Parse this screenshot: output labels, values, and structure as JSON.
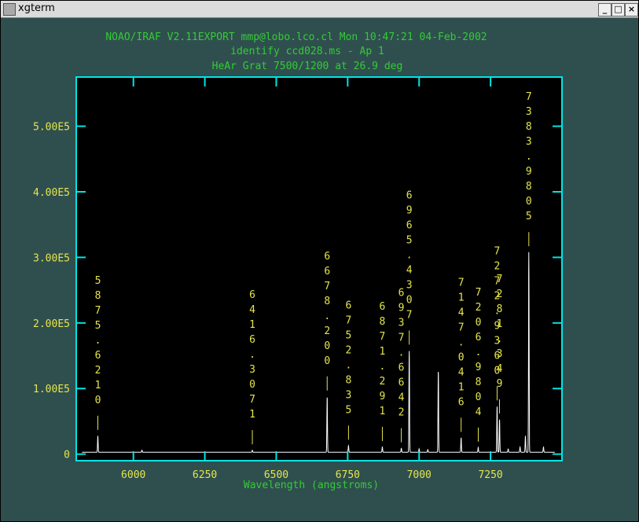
{
  "window": {
    "title": "xgterm",
    "minimize_glyph": "_",
    "maximize_glyph": "□",
    "close_glyph": "×"
  },
  "colors": {
    "background": "#2f4f4f",
    "axes": "#00e5e5",
    "header_text": "#33cc33",
    "tick_labels": "#e5e54c",
    "line_labels": "#e5e54c",
    "spectrum": "#ffffff",
    "plot_bg": "#000000"
  },
  "chart_data": {
    "type": "line",
    "title": "NOAO/IRAF V2.11EXPORT mmp@lobo.lco.cl Mon 10:47:21 04-Feb-2002",
    "subtitle": [
      "identify ccd028.ms - Ap 1",
      "HeAr Grat 7500/1200 at 26.9 deg"
    ],
    "xlabel": "Wavelength (angstroms)",
    "ylabel": "",
    "xlim": [
      5800,
      7500
    ],
    "ylim": [
      -10000,
      575000
    ],
    "xticks": [
      6000,
      6250,
      6500,
      6750,
      7000,
      7250
    ],
    "xtick_labels": [
      "6000",
      "6250",
      "6500",
      "6750",
      "7000",
      "7250"
    ],
    "yticks": [
      0,
      100000,
      200000,
      300000,
      400000,
      500000
    ],
    "ytick_labels": [
      "0",
      "1.00E5",
      "2.00E5",
      "3.00E5",
      "4.00E5",
      "5.00E5"
    ],
    "grid": false,
    "baseline": 3000,
    "peaks": [
      [
        5875.6,
        25000
      ],
      [
        6030,
        3000
      ],
      [
        6416.3,
        3000
      ],
      [
        6678.2,
        85000
      ],
      [
        6752.8,
        10000
      ],
      [
        6871.3,
        8000
      ],
      [
        6937.7,
        6000
      ],
      [
        6965.4,
        155000
      ],
      [
        7000,
        5000
      ],
      [
        7030.3,
        4000
      ],
      [
        7067.2,
        125000
      ],
      [
        7147.0,
        22000
      ],
      [
        7206.9,
        7000
      ],
      [
        7272.9,
        70000
      ],
      [
        7281.4,
        50000
      ],
      [
        7311.7,
        5000
      ],
      [
        7353.3,
        8000
      ],
      [
        7372.1,
        25000
      ],
      [
        7383.98,
        305000
      ],
      [
        7435.3,
        8000
      ]
    ],
    "line_ids": [
      {
        "wavelength": "5875.6210",
        "x": 5875.621,
        "y_peak": 25000
      },
      {
        "wavelength": "6416.3071",
        "x": 6416.307,
        "y_peak": 3000
      },
      {
        "wavelength": "6678.200",
        "x": 6678.2,
        "y_peak": 85000
      },
      {
        "wavelength": "6752.835",
        "x": 6752.835,
        "y_peak": 10000
      },
      {
        "wavelength": "6871.291",
        "x": 6871.291,
        "y_peak": 8000
      },
      {
        "wavelength": "6937.6642",
        "x": 6937.664,
        "y_peak": 6000
      },
      {
        "wavelength": "6965.4307",
        "x": 6965.431,
        "y_peak": 155000
      },
      {
        "wavelength": "7147.0416",
        "x": 7147.042,
        "y_peak": 22000
      },
      {
        "wavelength": "7206.9804",
        "x": 7206.98,
        "y_peak": 7000
      },
      {
        "wavelength": "7272.9360",
        "x": 7272.936,
        "y_peak": 70000
      },
      {
        "wavelength": "7281.349",
        "x": 7281.349,
        "y_peak": 50000
      },
      {
        "wavelength": "7383.9805",
        "x": 7383.981,
        "y_peak": 305000
      }
    ]
  }
}
